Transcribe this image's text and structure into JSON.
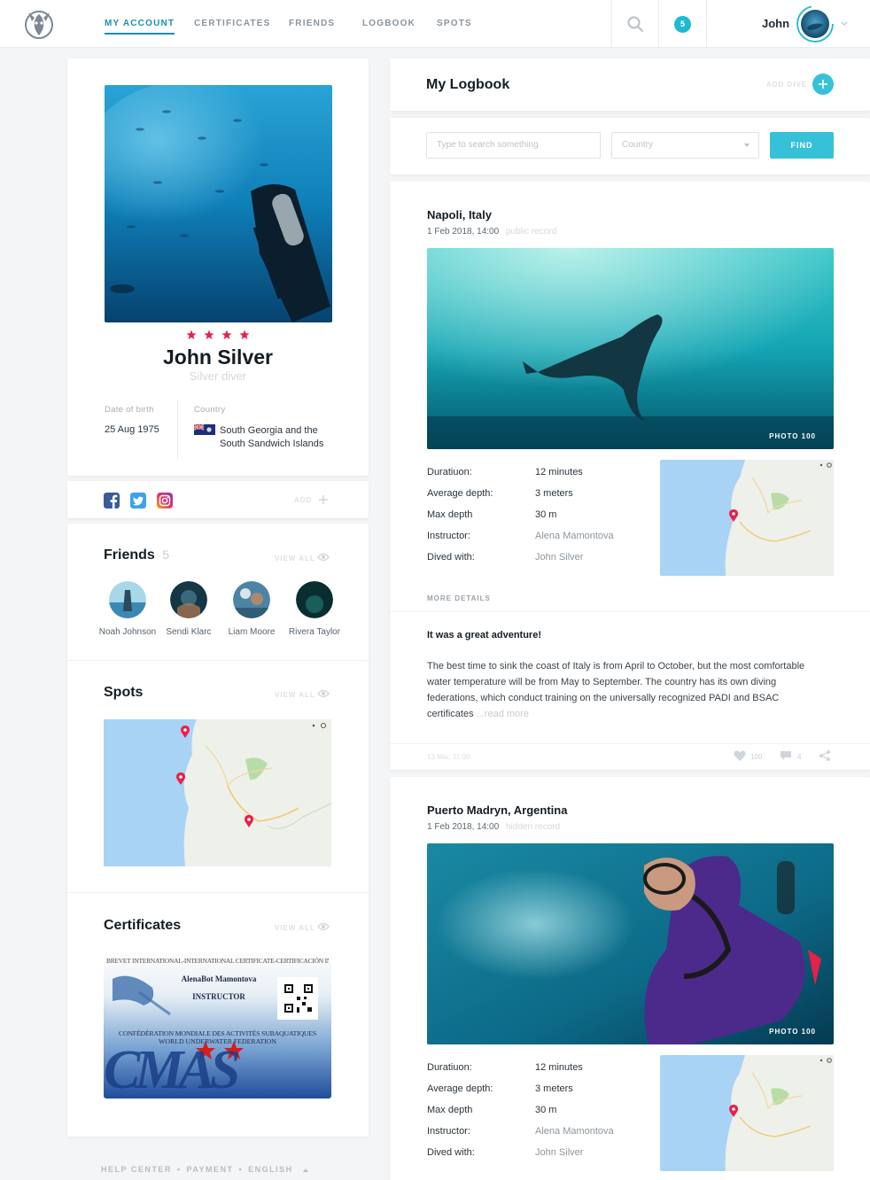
{
  "header": {
    "nav": [
      "MY ACCOUNT",
      "CERTIFICATES",
      "FRIENDS",
      "LOGBOOK",
      "SPOTS"
    ],
    "notifications": "5",
    "user_name": "John"
  },
  "profile": {
    "stars": 4,
    "name": "John Silver",
    "level": "Silver diver",
    "dob_label": "Date of birth",
    "dob": "25 Aug 1975",
    "country_label": "Country",
    "country_line1": "South Georgia and the",
    "country_line2": "South Sandwich Islands"
  },
  "social": {
    "add_label": "ADD",
    "icons": [
      "facebook-icon",
      "twitter-icon",
      "instagram-icon"
    ]
  },
  "friends": {
    "title": "Friends",
    "count": "5",
    "view_all": "VIEW ALL",
    "items": [
      "Noah Johnson",
      "Sendi Klarc",
      "Liam Moore",
      "Rivera Taylor"
    ]
  },
  "spots": {
    "title": "Spots",
    "view_all": "VIEW ALL"
  },
  "certificates": {
    "title": "Certificates",
    "view_all": "VIEW ALL",
    "card": {
      "banner": "BREVET INTERNATIONAL-INTERNATIONAL CERTIFICATE-CERTIFICACIÓN INTERNACIONAL",
      "holder": "AlenaBot Mamontova",
      "role": "INSTRUCTOR",
      "org1": "CONFÉDÉRATION MONDIALE DES ACTIVITÉS SUBAQUATIQUES",
      "org2": "WORLD UNDERWATER FEDERATION",
      "logo": "CMAS"
    }
  },
  "logbook": {
    "title": "My Logbook",
    "add_label": "ADD DIVE",
    "search_placeholder": "Type to search something",
    "country_placeholder": "Country",
    "find_label": "FIND"
  },
  "stat_labels": [
    "Duratiuon:",
    "Average depth:",
    "Max depth",
    "Instructor:",
    "Dived with:"
  ],
  "entries": [
    {
      "title": "Napoli, Italy",
      "date": "1 Feb 2018, 14:00",
      "visibility": "public record",
      "photo_label": "PHOTO 100",
      "stats": [
        "12 minutes",
        "3 meters",
        "30 m",
        "Alena Mamontova",
        "John Silver"
      ],
      "more_details": "MORE DETAILS",
      "story_title": "It was a great adventure!",
      "story": "The best time to sink the coast of Italy is from April to October, but the most comfortable water temperature will be from May to September. The country has its own diving federations, which conduct training on the universally recognized PADI and BSAC certificates",
      "read_more": "...read more",
      "footer_date": "13 Mar, 11:00",
      "likes": "100",
      "comments": "4"
    },
    {
      "title": "Puerto Madryn, Argentina",
      "date": "1 Feb 2018, 14:00",
      "visibility": "hidden record",
      "photo_label": "PHOTO 100",
      "stats": [
        "12 minutes",
        "3 meters",
        "30 m",
        "Alena Mamontova",
        "John Silver"
      ]
    }
  ],
  "footer": [
    "HELP CENTER",
    "PAYMENT",
    "ENGLISH"
  ],
  "colors": {
    "accent": "#1a8fb5",
    "primary_btn": "#37c1d9",
    "star": "#e8204a",
    "map_water": "#a9d3f5"
  }
}
